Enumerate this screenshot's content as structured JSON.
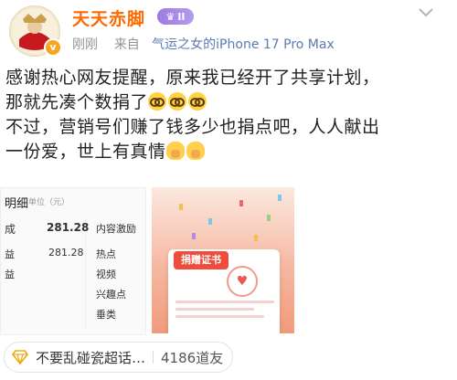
{
  "post": {
    "username": "天天赤脚",
    "level_badge": "II",
    "timestamp": "刚刚",
    "source_prefix": "来自",
    "source_device": "气运之女的iPhone 17 Pro Max",
    "line1": "感谢热心网友提醒，原来我已经开了共享计划，",
    "line2": "那就先凑个数捐了",
    "line3": "不过，营销号们赚了钱多少也捐点吧，人人献出",
    "line4": "一份爱，世上有真情",
    "emoji_a": "glasses-emoji",
    "emoji_b": "pray-emoji"
  },
  "left_image": {
    "title": "明细",
    "unit": "单位（元）",
    "rows": [
      {
        "label": "成",
        "value": "281.28",
        "right": "内容激励"
      },
      {
        "label": "益",
        "value": "281.28",
        "right": "热点"
      },
      {
        "label": "益",
        "value": "",
        "right": "视频"
      },
      {
        "label": "",
        "value": "",
        "right": "兴趣点"
      },
      {
        "label": "",
        "value": "",
        "right": "垂类"
      }
    ]
  },
  "right_image": {
    "cert_title": "捐赠证书"
  },
  "topic": {
    "label": "不要乱碰瓷超话…",
    "count": "4186道友"
  },
  "colors": {
    "username": "#ff6a00",
    "source_link": "#5b7bb3",
    "level_badge": "#9d7ae0",
    "cert_red": "#ef4d3b"
  }
}
